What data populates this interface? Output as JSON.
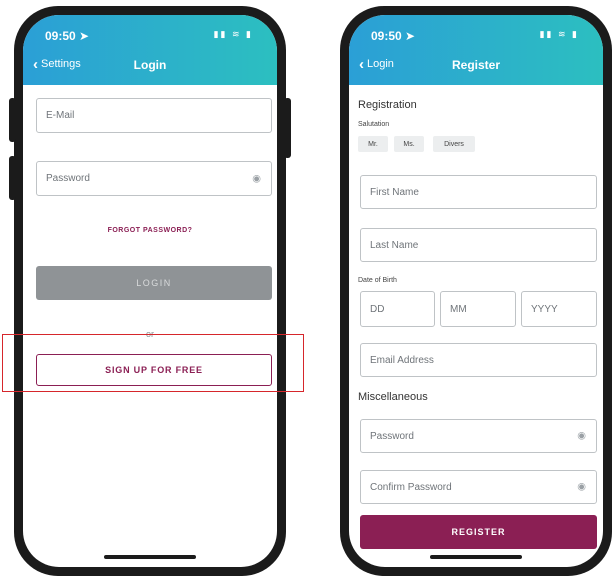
{
  "login": {
    "status_time": "09:50 ➤",
    "status_icons": "▮▮ ≋ ▮",
    "back_label": "Settings",
    "title": "Login",
    "email_placeholder": "E-Mail",
    "password_placeholder": "Password",
    "forgot_label": "FORGOT PASSWORD?",
    "login_button": "LOGIN",
    "or_text": "or",
    "signup_button": "SIGN UP FOR FREE"
  },
  "register": {
    "status_time": "09:50 ➤",
    "status_icons": "▮▮ ≋ ▮",
    "back_label": "Login",
    "title": "Register",
    "section_registration": "Registration",
    "salutation_label": "Salutation",
    "salutation_options": [
      "Mr.",
      "Ms.",
      "Divers"
    ],
    "first_name_placeholder": "First Name",
    "last_name_placeholder": "Last Name",
    "dob_label": "Date of Birth",
    "dob_day_placeholder": "DD",
    "dob_month_placeholder": "MM",
    "dob_year_placeholder": "YYYY",
    "email_placeholder": "Email Address",
    "section_misc": "Miscellaneous",
    "password_placeholder": "Password",
    "confirm_password_placeholder": "Confirm Password",
    "register_button": "REGISTER"
  },
  "colors": {
    "brand_primary": "#8b1f54",
    "appbar_gradient_start": "#2b9fd6",
    "appbar_gradient_end": "#2cbfc0",
    "highlight_outline": "#d6262b",
    "disabled_button": "#8f9396"
  },
  "icons": {
    "eye": "eye-icon",
    "back": "chevron-left-icon",
    "location": "location-arrow-icon"
  }
}
